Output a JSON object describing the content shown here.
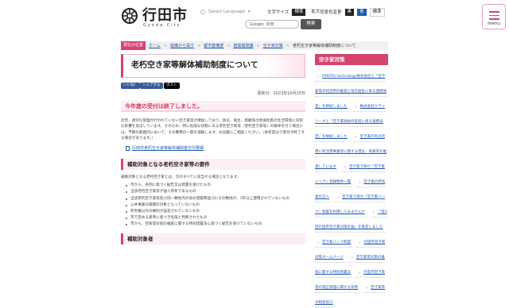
{
  "header": {
    "site_name": "行田市",
    "site_sub": "Gyoda City",
    "select_language": "Select Language",
    "font_size_label": "文字サイズ",
    "font_standard": "標準",
    "font_enlarge": "拡大",
    "bg_label": "背景色変更",
    "bg_black": "黒",
    "bg_blue": "青",
    "bg_standard": "標準",
    "search_provider": "Google",
    "search_placeholder": "検索",
    "search_button": "検索",
    "menu_label": "menu"
  },
  "breadcrumb": {
    "current_label": "現在の位置",
    "items": [
      "ホーム",
      "組織から探す",
      "都市整備部",
      "建築開発課",
      "空き家対策"
    ],
    "current_page": "老朽空き家等解体補助制度について"
  },
  "article": {
    "title": "老朽空き家等解体補助制度について",
    "share_buttons": [
      "いいね！",
      "シェアする",
      "ポスト"
    ],
    "updated": "更新日：2023年10月25日",
    "notice_heading": "今年度の受付は終了しました。",
    "paragraph": "近年、適切な管理が行われていない空き家等が増加しており、防災、衛生、景観等の地域住民の生活環境に深刻な影響を及ぼしています。そのため、特に危険な状態にある老朽空き家等（老朽空き家等）の解体を行う場合には、予算の範囲内において、その費用の一部を補助します。お気軽にご相談ください。（本年度分で受付が終了する場合があります。）",
    "doc_link": "行田市老朽空き家等解体補助金交付要綱",
    "section1_heading": "補助対象となる老朽空き家等の要件",
    "section1_intro": "補助対象となる老朽空き家とは、次のすべてに該当する場合となります。",
    "section1_list": [
      "市から、条例に基づく勧告又は措置を受けたもの",
      "当該老朽空き家等が個人所有であるもの",
      "当該老朽空き家等及び同一敷地内の他の建築物並びにその敷地が、1年以上使用されていないもの",
      "公共事業の補償の対象となっていないもの",
      "所有権以外の権利が設定されていないもの",
      "市で定める基準に基づき危険と判断されたもの",
      "市から、空家等対策の推進に関する特別措置法に基づく勧告を受けていないもの"
    ],
    "section2_heading": "補助対象者"
  },
  "sidebar": {
    "heading": "空き家対策",
    "items": [
      "FANTAS technology株式会社と「空き家等の利活用の推進と地方創生に係る連携協定」を締結しました",
      "株式会社クラッソーネと「空き家除却の促進に係る連携協定」を締結しました",
      "空き家の有効活用に利活用事業等に関する借主、売買等を推奨しています",
      "空き家で探せ『空き家バンク』登録物件一覧",
      "空き家の所有者の方へ",
      "空き家で探せ『空き家バンク』制度を利用してみませんか",
      "「第3回行田市空き家対策計画」を策定しました",
      "空き家バンク制度",
      "行田市空き家対策ホームページ",
      "空き家等対策の推進に関する特別措置法",
      "行田市空き家等の適正管理に関する条例",
      "空き家等の相談窓口"
    ]
  },
  "colors": {
    "accent": "#d4446f",
    "link": "#1f5ab3",
    "facebook": "#3b5998",
    "x": "#000000"
  }
}
